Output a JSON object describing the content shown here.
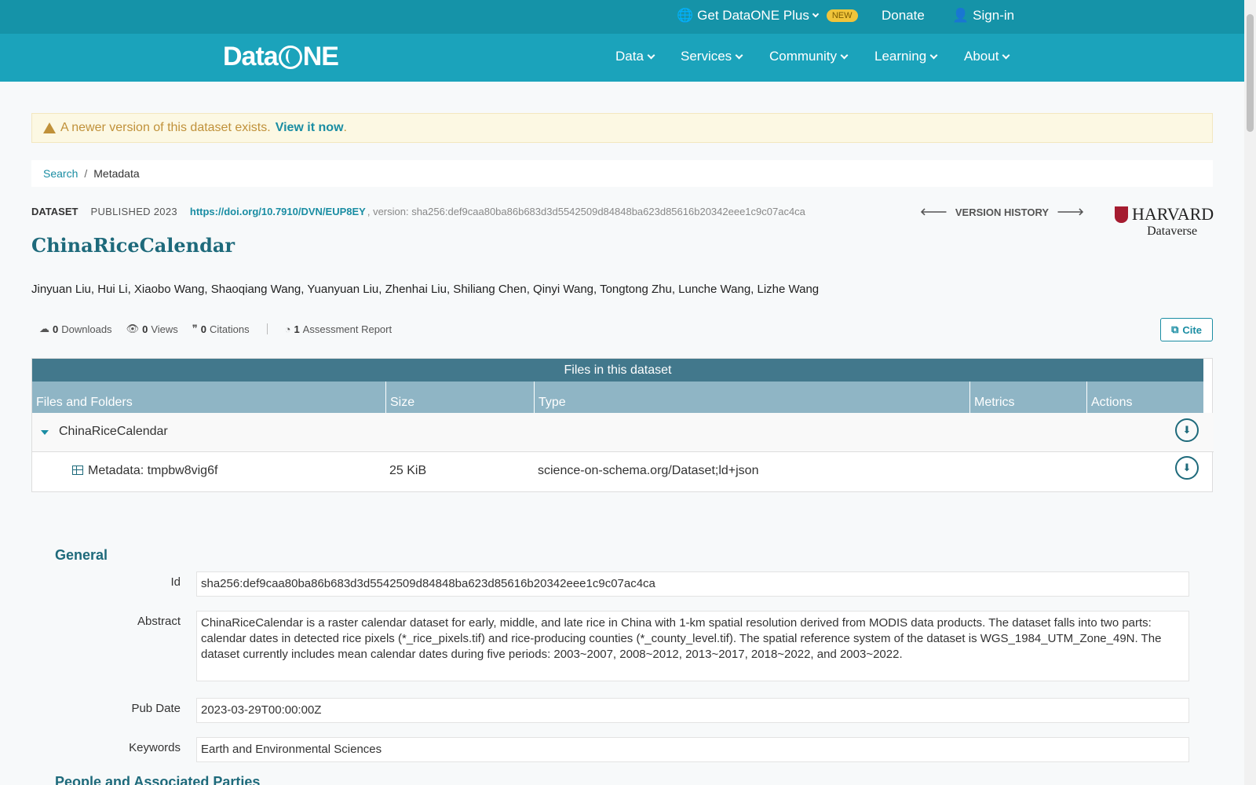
{
  "topbar": {
    "plus_label": "Get DataONE Plus",
    "new_badge": "NEW",
    "donate": "Donate",
    "signin": "Sign-in"
  },
  "nav": {
    "logo": "DataONE",
    "items": [
      "Data",
      "Services",
      "Community",
      "Learning",
      "About"
    ]
  },
  "alert": {
    "text": "A newer version of this dataset exists.",
    "link": "View it now",
    "suffix": "."
  },
  "breadcrumb": {
    "search": "Search",
    "sep": "/",
    "current": "Metadata"
  },
  "dataset": {
    "type_label": "DATASET",
    "published": "PUBLISHED 2023",
    "doi": "https://doi.org/10.7910/DVN/EUP8EY",
    "version": ", version: sha256:def9caa80ba86b683d3d5542509d84848ba623d85616b20342eee1c9c07ac4ca",
    "version_history": "VERSION HISTORY",
    "repo_line1": "HARVARD",
    "repo_line2": "Dataverse",
    "title": "ChinaRiceCalendar",
    "authors": "Jinyuan Liu, Hui Li, Xiaobo Wang, Shaoqiang Wang, Yuanyuan Liu, Zhenhai Liu, Shiliang Chen, Qinyi Wang, Tongtong Zhu, Lunche Wang, Lizhe Wang"
  },
  "stats": {
    "downloads_count": "0",
    "downloads_label": "Downloads",
    "views_count": "0",
    "views_label": "Views",
    "citations_count": "0",
    "citations_label": "Citations",
    "assessment_count": "1",
    "assessment_label": "Assessment Report",
    "cite_button": "Cite"
  },
  "files": {
    "title": "Files in this dataset",
    "columns": [
      "Files and Folders",
      "Size",
      "Type",
      "Metrics",
      "Actions"
    ],
    "folder": "ChinaRiceCalendar",
    "rows": [
      {
        "name": "Metadata: tmpbw8vig6f",
        "size": "25 KiB",
        "type": "science-on-schema.org/Dataset;ld+json"
      }
    ]
  },
  "general": {
    "heading": "General",
    "id_label": "Id",
    "id_value": "sha256:def9caa80ba86b683d3d5542509d84848ba623d85616b20342eee1c9c07ac4ca",
    "abstract_label": "Abstract",
    "abstract_value": "ChinaRiceCalendar is a raster calendar dataset for early, middle, and late rice in China with 1-km spatial resolution derived from MODIS data products. The dataset falls into two parts: calendar dates in detected rice pixels (*_rice_pixels.tif) and rice-producing counties (*_county_level.tif). The spatial reference system of the dataset is WGS_1984_UTM_Zone_49N. The dataset currently includes mean calendar dates during five periods: 2003~2007, 2008~2012, 2013~2017, 2018~2022, and 2003~2022.",
    "pubdate_label": "Pub Date",
    "pubdate_value": "2023-03-29T00:00:00Z",
    "keywords_label": "Keywords",
    "keywords_value": "Earth and Environmental Sciences"
  },
  "people_heading": "People and Associated Parties",
  "colors": {
    "topbar": "#1593a8",
    "navbar": "#1ba3bb",
    "accent": "#1a8da3",
    "title": "#1e6a7b"
  }
}
